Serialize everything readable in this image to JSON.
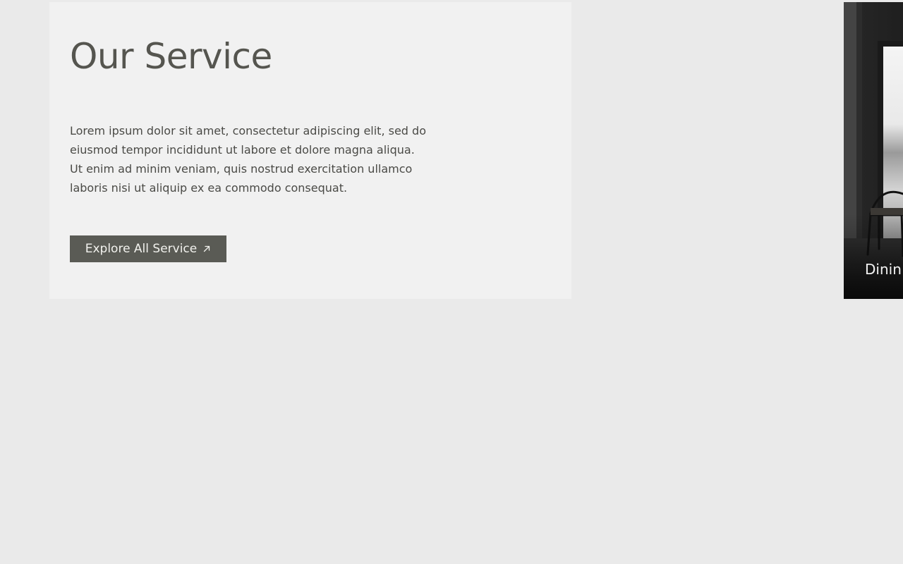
{
  "service": {
    "title": "Our Service",
    "description_lines": [
      "Lorem ipsum dolor sit amet, consectetur adipiscing elit, sed do",
      "eiusmod tempor incididunt ut labore et dolore magna aliqua.",
      "Ut enim ad minim veniam, quis nostrud exercitation ullamco",
      "laboris nisi ut aliquip ex ea commodo consequat."
    ],
    "button_label": "Explore All Service",
    "button_icon": "arrow-up-right-icon"
  },
  "gallery": {
    "items": [
      {
        "caption": "Dinin",
        "image": "dining-room-photo"
      }
    ]
  },
  "colors": {
    "page_background": "#eaeaea",
    "card_background": "#f1f1f1",
    "title_text": "#55554f",
    "body_text": "#4a4a46",
    "button_background": "#5a5b55",
    "button_text": "#f2f2ee"
  }
}
